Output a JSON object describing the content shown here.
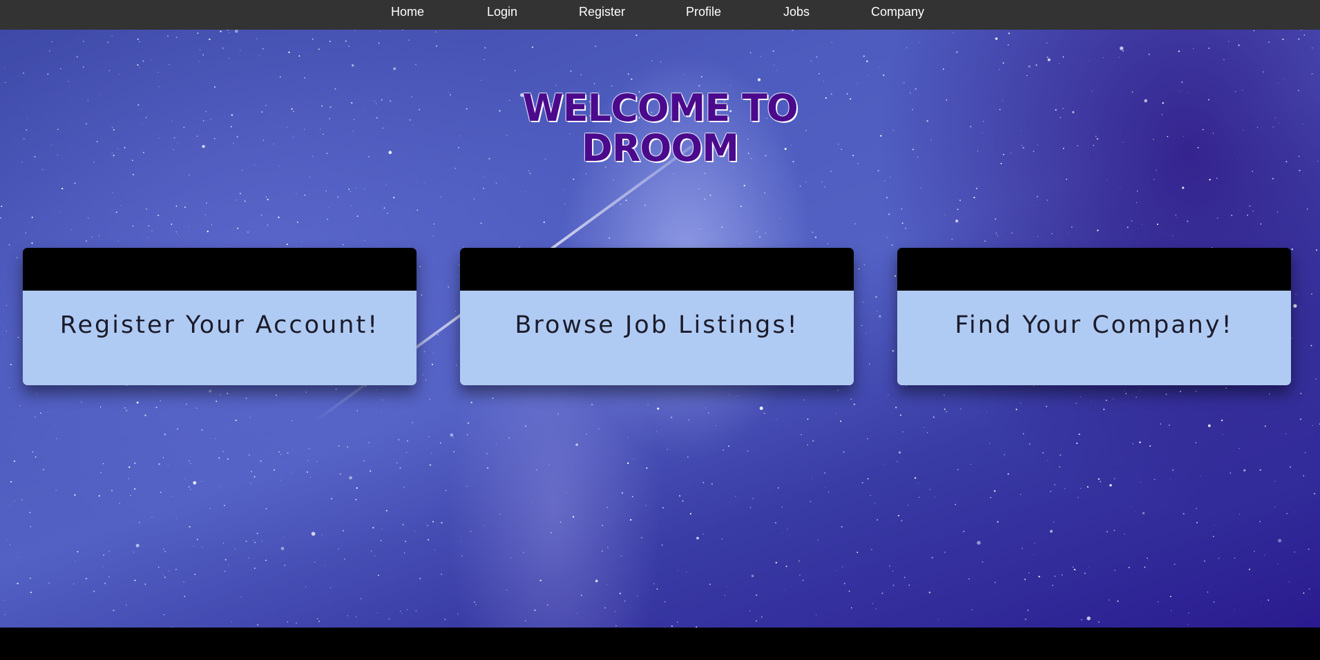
{
  "nav": {
    "items": [
      {
        "label": "Home"
      },
      {
        "label": "Login"
      },
      {
        "label": "Register"
      },
      {
        "label": "Profile"
      },
      {
        "label": "Jobs"
      },
      {
        "label": "Company"
      }
    ]
  },
  "hero": {
    "title_line1": "WELCOME TO",
    "title_line2": "DROOM"
  },
  "cards": [
    {
      "label": "Register Your Account!"
    },
    {
      "label": "Browse Job Listings!"
    },
    {
      "label": "Find Your Company!"
    }
  ],
  "colors": {
    "navbar": "#333333",
    "title": "#4b0a8c",
    "card_body": "#b0cbf3",
    "card_header": "#000000"
  }
}
